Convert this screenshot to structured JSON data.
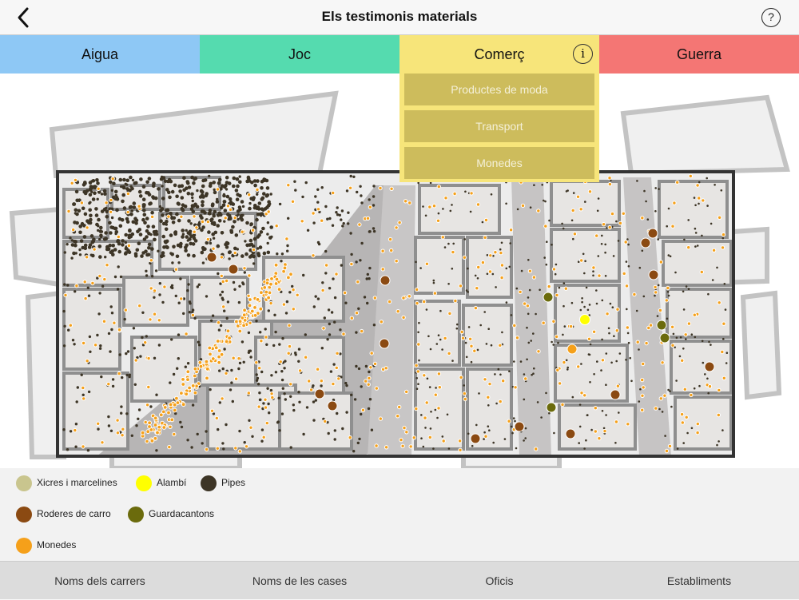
{
  "header": {
    "title": "Els testimonis materials",
    "back_icon": "chevron-left-icon",
    "help_label": "?"
  },
  "tabs": [
    {
      "label": "Aigua",
      "color": "#8ec8f5"
    },
    {
      "label": "Joc",
      "color": "#55dbaf"
    },
    {
      "label": "Comerç",
      "color": "#f7e57a",
      "info_label": "i"
    },
    {
      "label": "Guerra",
      "color": "#f47674"
    }
  ],
  "dropdown": {
    "items": [
      "Productes de moda",
      "Transport",
      "Monedes"
    ]
  },
  "legend": [
    {
      "label": "Xicres i marcelines",
      "color": "#c9c58e"
    },
    {
      "label": "Alambí",
      "color": "#ffff00"
    },
    {
      "label": "Pipes",
      "color": "#3d3526"
    },
    {
      "label": "Roderes de carro",
      "color": "#8b4a12"
    },
    {
      "label": "Guardacantons",
      "color": "#6b6b0c"
    },
    {
      "label": "Monedes",
      "color": "#f5a01a"
    }
  ],
  "bottom_bar": [
    "Noms dels carrers",
    "Noms de les cases",
    "Oficis",
    "Establiments"
  ]
}
